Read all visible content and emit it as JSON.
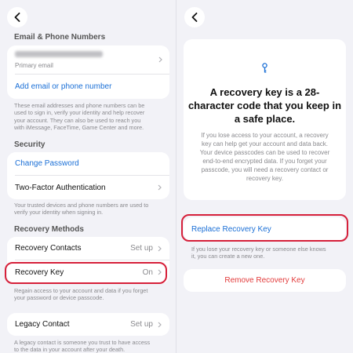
{
  "left": {
    "email_section_header": "Email & Phone Numbers",
    "primary_email_label": "Primary email",
    "add_email": "Add email or phone number",
    "email_note": [
      "These email addresses and phone numbers can be",
      "used to sign in, verify your identity and help recover",
      "your account. They can also be used to reach you",
      "with iMessage, FaceTime, Game Center and more."
    ],
    "security_header": "Security",
    "change_password": "Change Password",
    "two_factor": "Two-Factor Authentication",
    "two_factor_note": [
      "Your trusted devices and phone numbers are used to",
      "verify your identity when signing in."
    ],
    "recovery_header": "Recovery Methods",
    "recovery_contacts": "Recovery Contacts",
    "recovery_contacts_value": "Set up",
    "recovery_key": "Recovery Key",
    "recovery_key_value": "On",
    "recovery_note": [
      "Regain access to your account and data if you forget",
      "your password or device passcode."
    ],
    "legacy_contact": "Legacy Contact",
    "legacy_contact_value": "Set up",
    "legacy_note": [
      "A legacy contact is someone you trust to have access",
      "to the data in your account after your death."
    ]
  },
  "right": {
    "title": [
      "A recovery key is a 28-",
      "character code that you keep in",
      "a safe place."
    ],
    "body": [
      "If you lose access to your account, a recovery",
      "key can help get your account and data back.",
      "Your device passcodes can be used to recover",
      "end-to-end encrypted data. If you forget your",
      "passcode, you will need a recovery contact or",
      "recovery key."
    ],
    "replace_key": "Replace Recovery Key",
    "replace_note": [
      "If you lose your recovery key or someone else knows",
      "it, you can create a new one."
    ],
    "remove_key": "Remove Recovery Key"
  },
  "colors": {
    "link_blue": "#1a6fd6",
    "highlight_red": "#d6203a",
    "destructive_red": "#e23b3b",
    "background": "#f2f2f7"
  },
  "icons": {
    "back": "chevron-left-icon",
    "disclosure": "chevron-right-icon",
    "key": "key-icon"
  }
}
